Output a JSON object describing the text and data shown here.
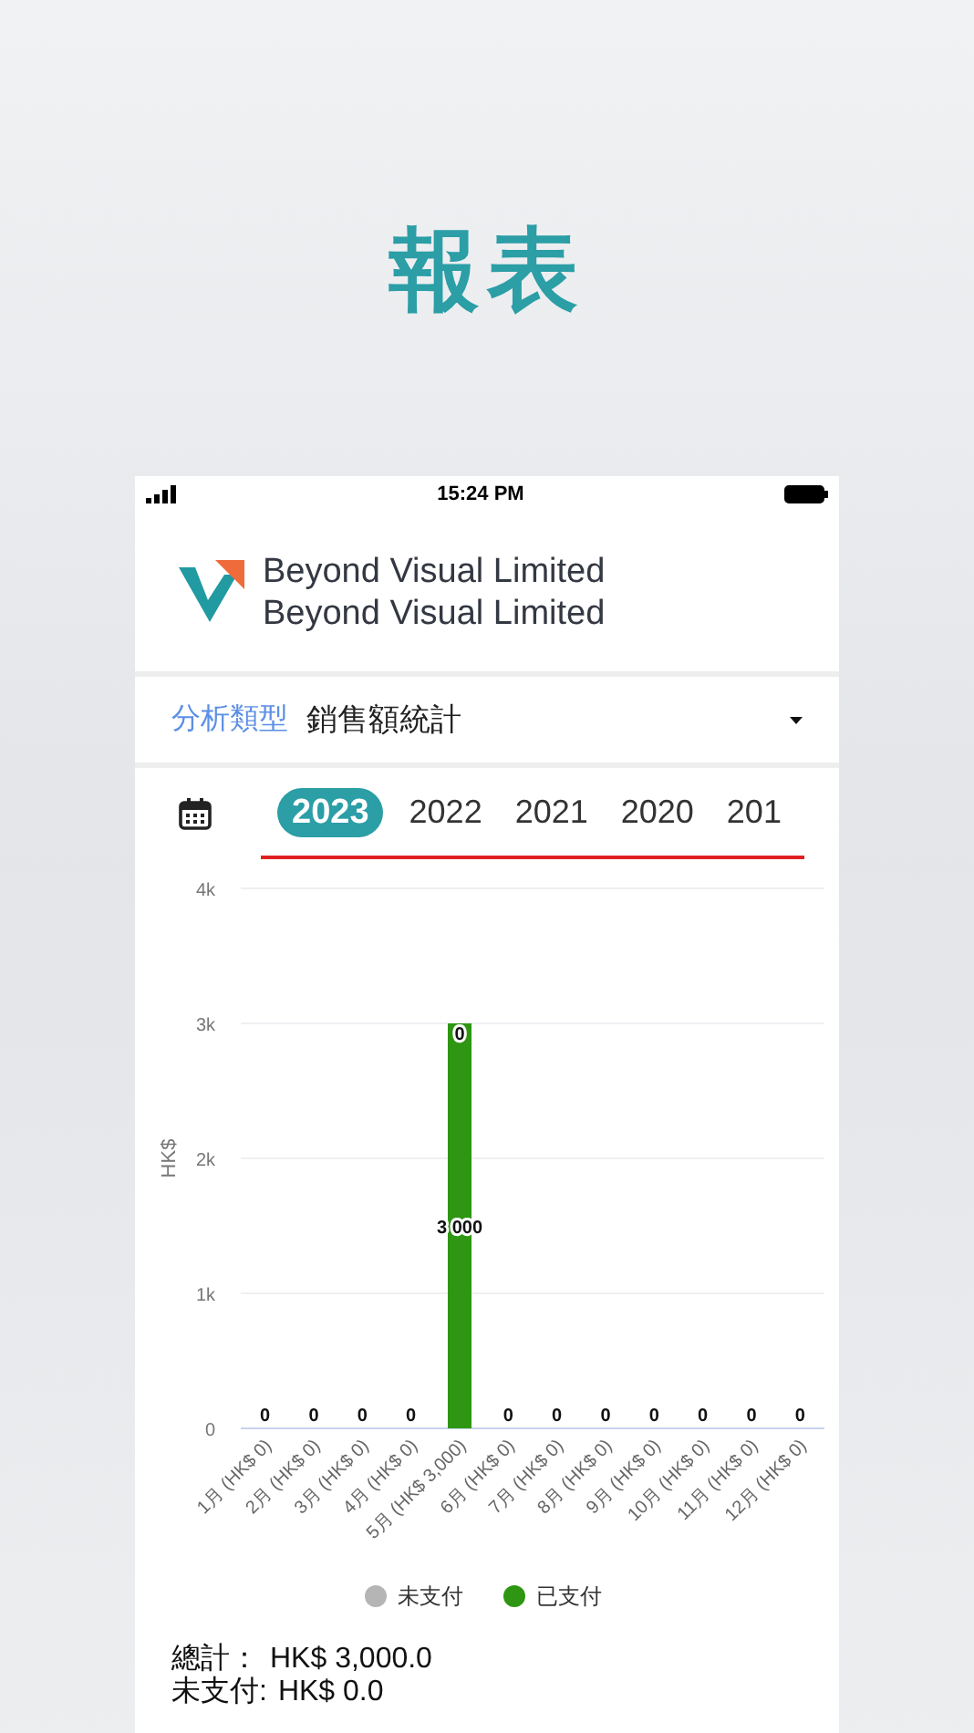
{
  "page_title": "報表",
  "status_bar": {
    "time": "15:24 PM"
  },
  "header": {
    "company_lines": [
      "Beyond Visual Limited",
      "Beyond Visual Limited"
    ]
  },
  "analysis_type": {
    "label": "分析類型",
    "value": "銷售額統計"
  },
  "year_tabs": [
    {
      "label": "2023",
      "selected": true
    },
    {
      "label": "2022",
      "selected": false
    },
    {
      "label": "2021",
      "selected": false
    },
    {
      "label": "2020",
      "selected": false
    },
    {
      "label": "201",
      "selected": false
    }
  ],
  "chart": {
    "chart_data": {
      "type": "bar",
      "stacked": true,
      "ylabel": "HK$",
      "ylim": [
        0,
        4000
      ],
      "yticks": [
        {
          "value": 0,
          "label": "0"
        },
        {
          "value": 1000,
          "label": "1k"
        },
        {
          "value": 2000,
          "label": "2k"
        },
        {
          "value": 3000,
          "label": "3k"
        },
        {
          "value": 4000,
          "label": "4k"
        }
      ],
      "categories": [
        "1月 (HK$ 0)",
        "2月 (HK$ 0)",
        "3月 (HK$ 0)",
        "4月 (HK$ 0)",
        "5月 (HK$ 3,000)",
        "6月 (HK$ 0)",
        "7月 (HK$ 0)",
        "8月 (HK$ 0)",
        "9月 (HK$ 0)",
        "10月 (HK$ 0)",
        "11月 (HK$ 0)",
        "12月 (HK$ 0)"
      ],
      "series": [
        {
          "name": "已支付",
          "color": "#2e9612",
          "values": [
            0,
            0,
            0,
            0,
            3000,
            0,
            0,
            0,
            0,
            0,
            0,
            0
          ]
        },
        {
          "name": "未支付",
          "color": "#b5b5b5",
          "values": [
            0,
            0,
            0,
            0,
            0,
            0,
            0,
            0,
            0,
            0,
            0,
            0
          ]
        }
      ],
      "grid": true,
      "value_labels": [
        [
          null,
          null,
          null,
          null,
          "3 000",
          null,
          null,
          null,
          null,
          null,
          null,
          null
        ],
        [
          "0",
          "0",
          "0",
          "0",
          "0",
          "0",
          "0",
          "0",
          "0",
          "0",
          "0",
          "0"
        ]
      ]
    }
  },
  "totals": [
    {
      "label": "總計：",
      "value": "HK$ 3,000.0"
    },
    {
      "label": "未支付:",
      "value": "HK$ 0.0"
    }
  ]
}
